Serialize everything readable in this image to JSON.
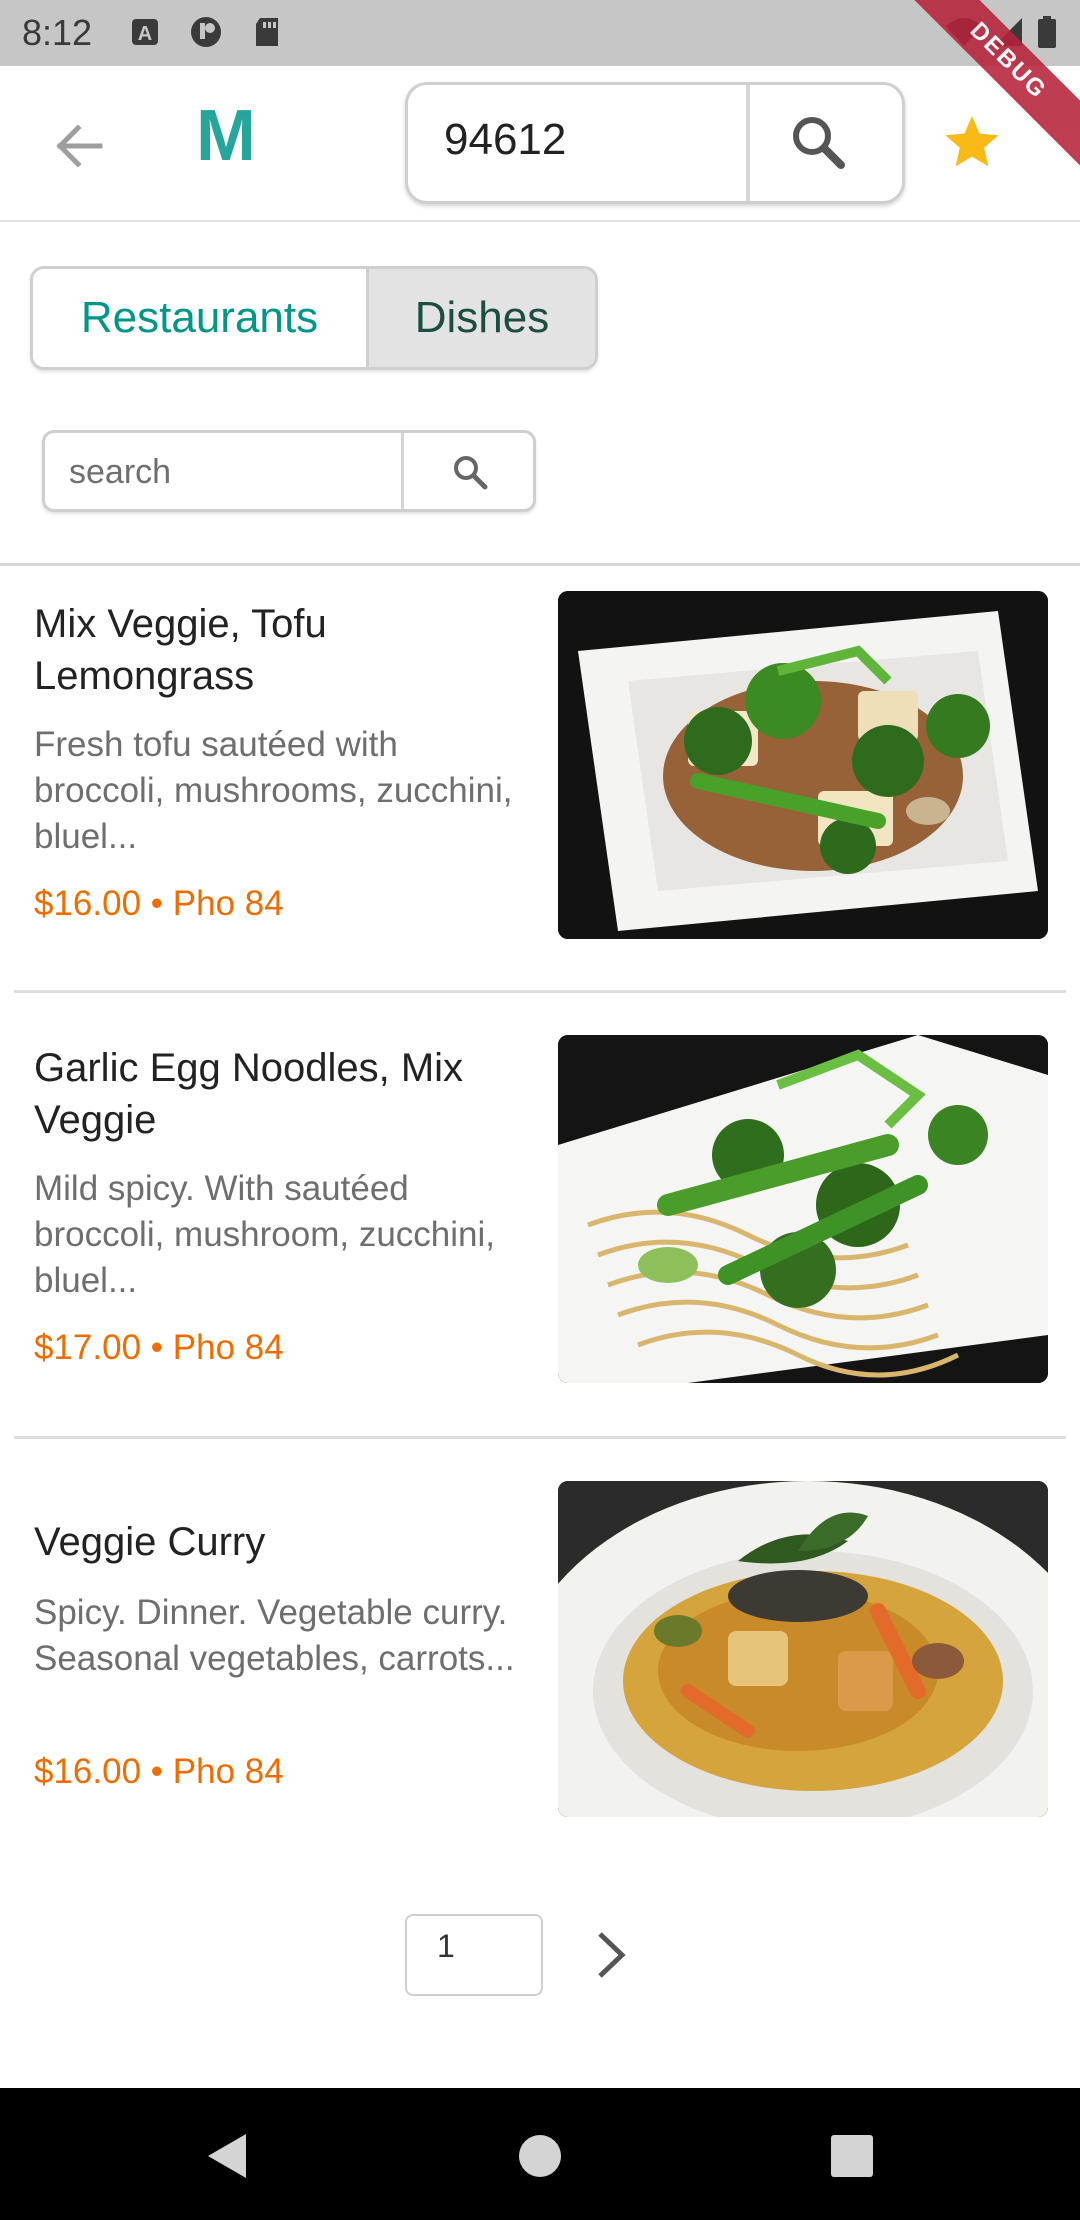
{
  "status_bar": {
    "time": "8:12",
    "icons": [
      "keyboard-a-icon",
      "app-icon",
      "sd-card-icon",
      "wifi-icon",
      "signal-icon",
      "battery-icon"
    ],
    "debug_label": "DEBUG"
  },
  "app_bar": {
    "logo": "M",
    "zip": "94612",
    "colors": {
      "logo": "#26a69a",
      "star": "#f9b916"
    }
  },
  "tabs": [
    {
      "label": "Restaurants",
      "selected": true
    },
    {
      "label": "Dishes",
      "selected": false
    }
  ],
  "filter": {
    "placeholder": "search",
    "value": ""
  },
  "dishes": [
    {
      "title": "Mix Veggie, Tofu Lemongrass",
      "description": "Fresh tofu sautéed with broccoli, mushrooms, zucchini, bluel...",
      "meta": "$16.00 • Pho 84",
      "image": "tofu-veggie-plate"
    },
    {
      "title": "Garlic Egg Noodles, Mix Veggie",
      "description": "Mild spicy. With sautéed broccoli, mushroom, zucchini, bluel...",
      "meta": "$17.00 • Pho 84",
      "image": "noodles-veggie-plate"
    },
    {
      "title": "Veggie Curry",
      "description": "Spicy. Dinner. Vegetable curry. Seasonal vegetables, carrots...",
      "meta": "$16.00 • Pho 84",
      "image": "curry-bowl"
    }
  ],
  "pagination": {
    "page": "1"
  },
  "colors": {
    "accent": "#009688",
    "price": "#ef6c00"
  }
}
